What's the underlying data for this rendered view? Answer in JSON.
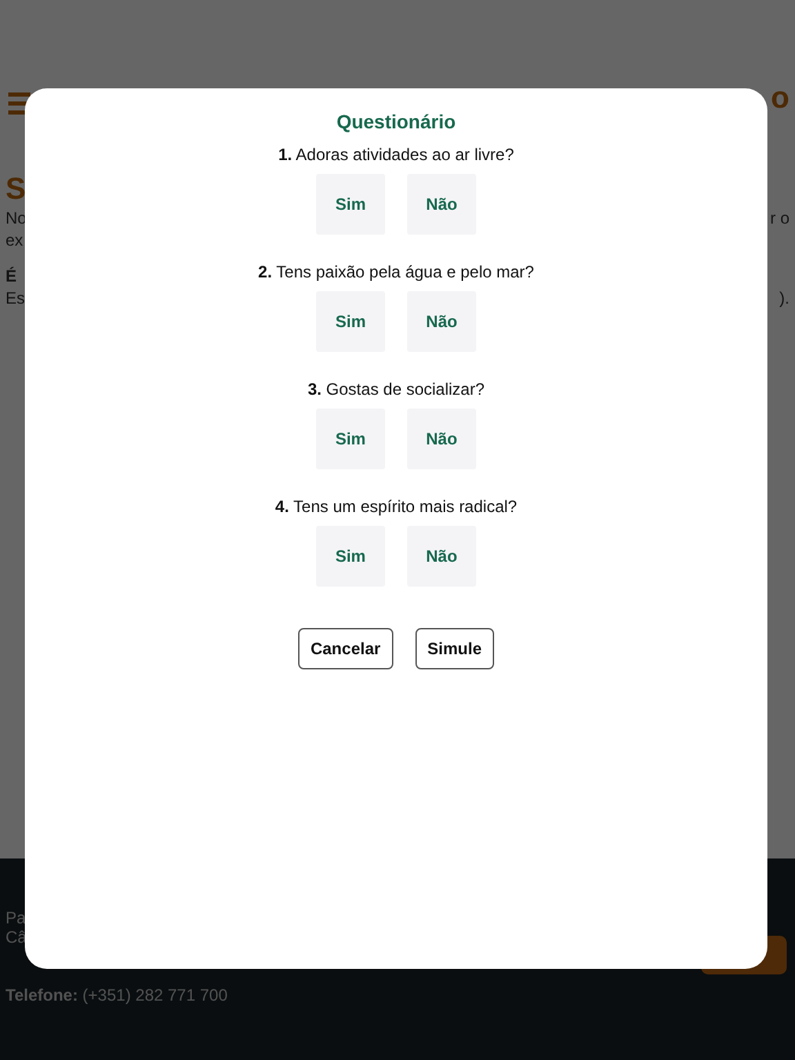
{
  "background": {
    "header_right": "o",
    "heading": "S",
    "lines": [
      {
        "left": "No",
        "right": "r o"
      },
      {
        "left": "ex"
      }
    ],
    "subheading": "É",
    "lines2": [
      {
        "left": "Es",
        "right": ")."
      }
    ],
    "footer_lines": [
      "Pa",
      "Câ"
    ],
    "phone_label": "Telefone:",
    "phone": "(+351) 282 771 700"
  },
  "dialog": {
    "title": "Questionário",
    "questions": [
      {
        "text": "**1.** Adoras atividades ao ar livre?",
        "options": [
          {
            "label": "Sim",
            "selected": false
          },
          {
            "label": "Não",
            "selected": false
          }
        ]
      },
      {
        "text": "**2.** Tens paixão pela água e pelo mar?",
        "options": [
          {
            "label": "Sim",
            "selected": false
          },
          {
            "label": "Não",
            "selected": false
          }
        ]
      },
      {
        "text": "**3.** Gostas de socializar?",
        "options": [
          {
            "label": "Sim",
            "selected": false
          },
          {
            "label": "Não",
            "selected": false
          }
        ]
      },
      {
        "text": "**4.** Tens um espírito mais radical?",
        "options": [
          {
            "label": "Sim",
            "selected": false
          },
          {
            "label": "Não",
            "selected": false
          }
        ]
      }
    ],
    "buttons": [
      "Cancelar",
      "Simule"
    ]
  }
}
